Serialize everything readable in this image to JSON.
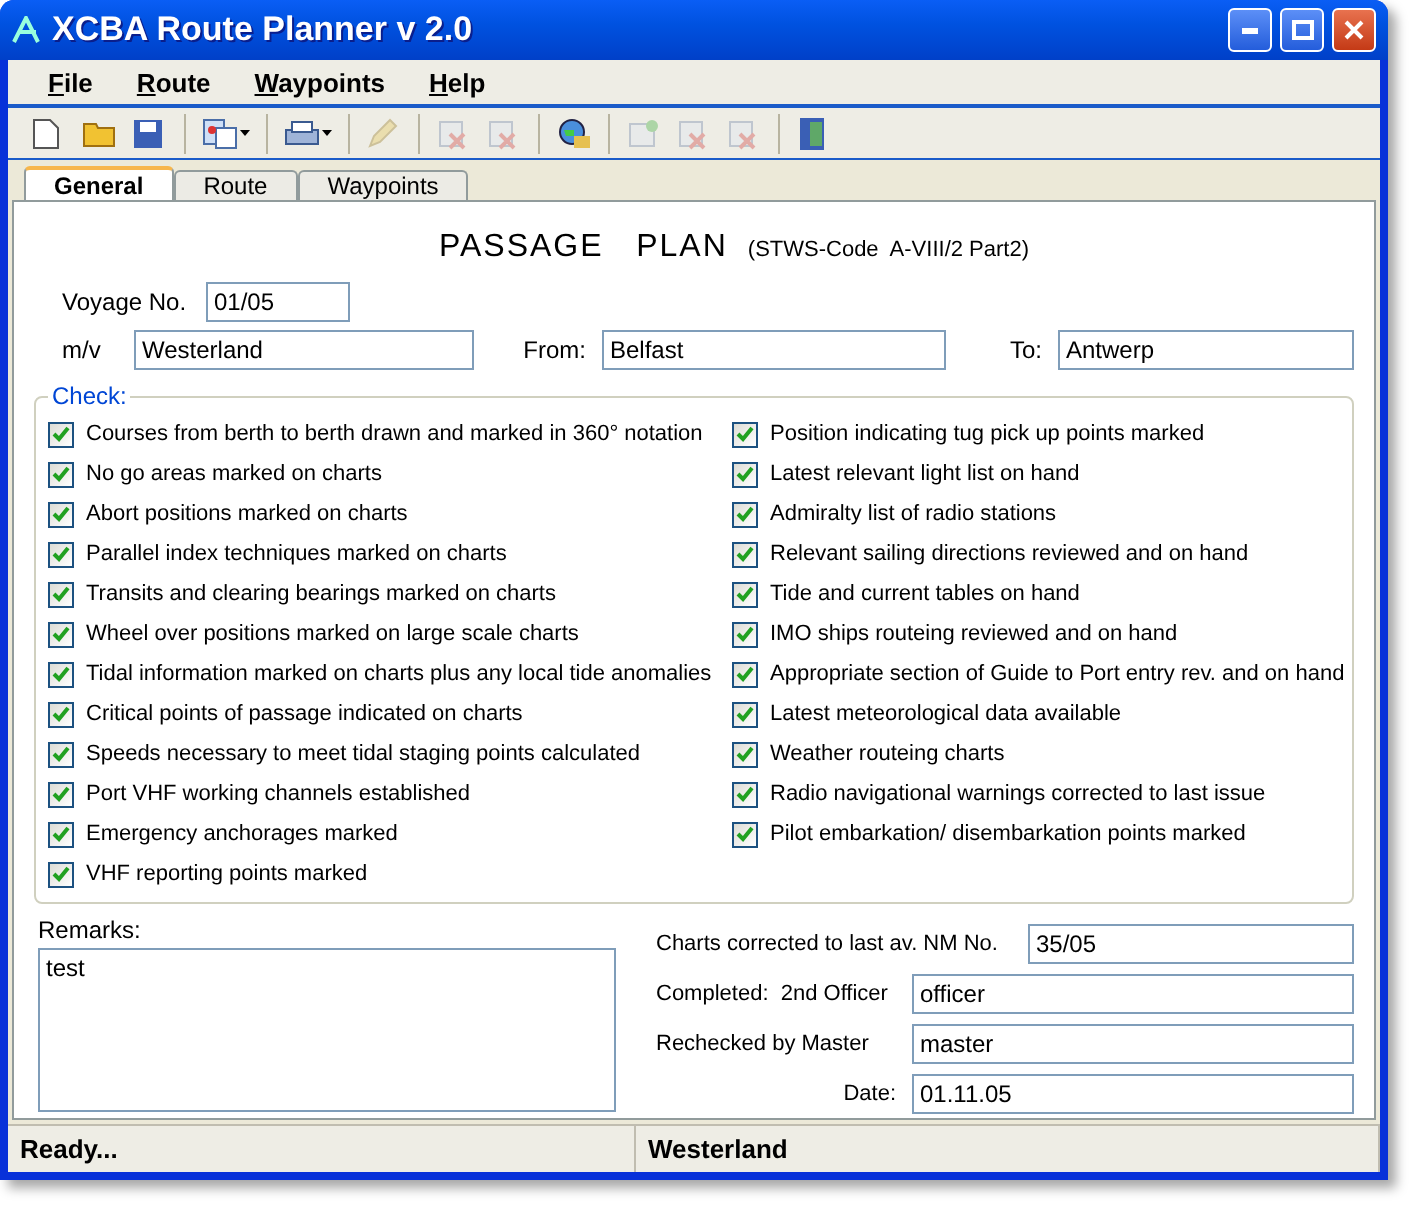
{
  "window": {
    "title": "XCBA Route Planner v 2.0"
  },
  "menu": [
    {
      "label": "File"
    },
    {
      "label": "Route"
    },
    {
      "label": "Waypoints"
    },
    {
      "label": "Help"
    }
  ],
  "toolbar": [
    {
      "kind": "new",
      "disabled": false
    },
    {
      "kind": "open",
      "disabled": false
    },
    {
      "kind": "save",
      "disabled": false
    },
    {
      "kind": "separator"
    },
    {
      "kind": "import",
      "disabled": false,
      "dropdown": true
    },
    {
      "kind": "separator"
    },
    {
      "kind": "print",
      "disabled": false,
      "dropdown": true
    },
    {
      "kind": "separator"
    },
    {
      "kind": "pencil",
      "disabled": true
    },
    {
      "kind": "separator"
    },
    {
      "kind": "delete",
      "disabled": true
    },
    {
      "kind": "delete",
      "disabled": true
    },
    {
      "kind": "separator"
    },
    {
      "kind": "globe",
      "disabled": false
    },
    {
      "kind": "separator"
    },
    {
      "kind": "add",
      "disabled": true
    },
    {
      "kind": "delete",
      "disabled": true
    },
    {
      "kind": "delete",
      "disabled": true
    },
    {
      "kind": "separator"
    },
    {
      "kind": "exit",
      "disabled": false
    }
  ],
  "tabs": [
    {
      "label": "General",
      "selected": true
    },
    {
      "label": "Route",
      "selected": false
    },
    {
      "label": "Waypoints",
      "selected": false
    }
  ],
  "form": {
    "title": "PASSAGE   PLAN",
    "subtitle": "(STWS-Code  A-VIII/2 Part2)",
    "voyage": {
      "label": "Voyage No.",
      "value": "01/05"
    },
    "vessel": {
      "label": "m/v",
      "value": "Westerland"
    },
    "from": {
      "label": "From:",
      "value": "Belfast"
    },
    "to": {
      "label": "To:",
      "value": "Antwerp"
    }
  },
  "check": {
    "label": "Check:",
    "columns": [
      [
        {
          "label": "Courses from berth to berth drawn and marked in 360° notation",
          "checked": true
        },
        {
          "label": "No go areas marked on charts",
          "checked": true
        },
        {
          "label": "Abort positions marked on charts",
          "checked": true
        },
        {
          "label": "Parallel index techniques marked on charts",
          "checked": true
        },
        {
          "label": "Transits and clearing bearings marked on charts",
          "checked": true
        },
        {
          "label": "Wheel over positions marked on large scale charts",
          "checked": true
        },
        {
          "label": "Tidal information marked on charts plus any local tide anomalies",
          "checked": true
        },
        {
          "label": "Critical points of passage indicated on charts",
          "checked": true
        },
        {
          "label": "Speeds necessary to meet tidal staging points calculated",
          "checked": true
        },
        {
          "label": "Port VHF working channels established",
          "checked": true
        },
        {
          "label": "Emergency anchorages marked",
          "checked": true
        },
        {
          "label": "VHF reporting points marked",
          "checked": true
        }
      ],
      [
        {
          "label": "Position indicating tug pick up points marked",
          "checked": true
        },
        {
          "label": "Latest relevant light list on hand",
          "checked": true
        },
        {
          "label": "Admiralty list of radio stations",
          "checked": true
        },
        {
          "label": "Relevant sailing directions reviewed and on hand",
          "checked": true
        },
        {
          "label": "Tide and current tables on hand",
          "checked": true
        },
        {
          "label": "IMO ships routeing reviewed and on hand",
          "checked": true
        },
        {
          "label": "Appropriate section of Guide to Port entry rev. and on hand",
          "checked": true
        },
        {
          "label": "Latest meteorological data available",
          "checked": true
        },
        {
          "label": "Weather routeing charts",
          "checked": true
        },
        {
          "label": "Radio navigational warnings corrected  to last issue",
          "checked": true
        },
        {
          "label": "Pilot embarkation/ disembarkation points marked",
          "checked": true
        }
      ]
    ]
  },
  "remarks": {
    "label": "Remarks:",
    "value": "test"
  },
  "signoff": [
    {
      "label": "Charts corrected to last av. NM No.",
      "value": "35/05"
    },
    {
      "label": "Completed:  2nd Officer",
      "value": "officer"
    },
    {
      "label": "Rechecked by Master",
      "value": "master"
    },
    {
      "label": "Date:",
      "value": "01.11.05"
    }
  ],
  "status_bar": [
    "Ready...",
    "Westerland"
  ]
}
